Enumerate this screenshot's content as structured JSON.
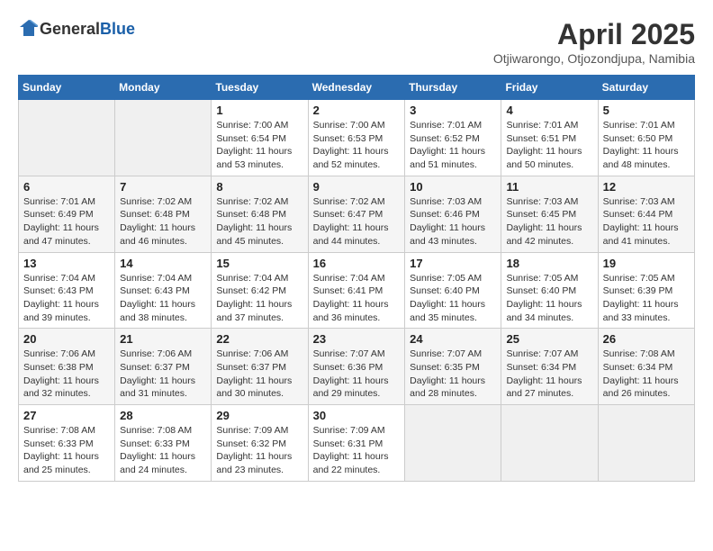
{
  "header": {
    "logo_general": "General",
    "logo_blue": "Blue",
    "title": "April 2025",
    "location": "Otjiwarongo, Otjozondjupa, Namibia"
  },
  "weekdays": [
    "Sunday",
    "Monday",
    "Tuesday",
    "Wednesday",
    "Thursday",
    "Friday",
    "Saturday"
  ],
  "weeks": [
    [
      {
        "day": "",
        "info": ""
      },
      {
        "day": "",
        "info": ""
      },
      {
        "day": "1",
        "info": "Sunrise: 7:00 AM\nSunset: 6:54 PM\nDaylight: 11 hours and 53 minutes."
      },
      {
        "day": "2",
        "info": "Sunrise: 7:00 AM\nSunset: 6:53 PM\nDaylight: 11 hours and 52 minutes."
      },
      {
        "day": "3",
        "info": "Sunrise: 7:01 AM\nSunset: 6:52 PM\nDaylight: 11 hours and 51 minutes."
      },
      {
        "day": "4",
        "info": "Sunrise: 7:01 AM\nSunset: 6:51 PM\nDaylight: 11 hours and 50 minutes."
      },
      {
        "day": "5",
        "info": "Sunrise: 7:01 AM\nSunset: 6:50 PM\nDaylight: 11 hours and 48 minutes."
      }
    ],
    [
      {
        "day": "6",
        "info": "Sunrise: 7:01 AM\nSunset: 6:49 PM\nDaylight: 11 hours and 47 minutes."
      },
      {
        "day": "7",
        "info": "Sunrise: 7:02 AM\nSunset: 6:48 PM\nDaylight: 11 hours and 46 minutes."
      },
      {
        "day": "8",
        "info": "Sunrise: 7:02 AM\nSunset: 6:48 PM\nDaylight: 11 hours and 45 minutes."
      },
      {
        "day": "9",
        "info": "Sunrise: 7:02 AM\nSunset: 6:47 PM\nDaylight: 11 hours and 44 minutes."
      },
      {
        "day": "10",
        "info": "Sunrise: 7:03 AM\nSunset: 6:46 PM\nDaylight: 11 hours and 43 minutes."
      },
      {
        "day": "11",
        "info": "Sunrise: 7:03 AM\nSunset: 6:45 PM\nDaylight: 11 hours and 42 minutes."
      },
      {
        "day": "12",
        "info": "Sunrise: 7:03 AM\nSunset: 6:44 PM\nDaylight: 11 hours and 41 minutes."
      }
    ],
    [
      {
        "day": "13",
        "info": "Sunrise: 7:04 AM\nSunset: 6:43 PM\nDaylight: 11 hours and 39 minutes."
      },
      {
        "day": "14",
        "info": "Sunrise: 7:04 AM\nSunset: 6:43 PM\nDaylight: 11 hours and 38 minutes."
      },
      {
        "day": "15",
        "info": "Sunrise: 7:04 AM\nSunset: 6:42 PM\nDaylight: 11 hours and 37 minutes."
      },
      {
        "day": "16",
        "info": "Sunrise: 7:04 AM\nSunset: 6:41 PM\nDaylight: 11 hours and 36 minutes."
      },
      {
        "day": "17",
        "info": "Sunrise: 7:05 AM\nSunset: 6:40 PM\nDaylight: 11 hours and 35 minutes."
      },
      {
        "day": "18",
        "info": "Sunrise: 7:05 AM\nSunset: 6:40 PM\nDaylight: 11 hours and 34 minutes."
      },
      {
        "day": "19",
        "info": "Sunrise: 7:05 AM\nSunset: 6:39 PM\nDaylight: 11 hours and 33 minutes."
      }
    ],
    [
      {
        "day": "20",
        "info": "Sunrise: 7:06 AM\nSunset: 6:38 PM\nDaylight: 11 hours and 32 minutes."
      },
      {
        "day": "21",
        "info": "Sunrise: 7:06 AM\nSunset: 6:37 PM\nDaylight: 11 hours and 31 minutes."
      },
      {
        "day": "22",
        "info": "Sunrise: 7:06 AM\nSunset: 6:37 PM\nDaylight: 11 hours and 30 minutes."
      },
      {
        "day": "23",
        "info": "Sunrise: 7:07 AM\nSunset: 6:36 PM\nDaylight: 11 hours and 29 minutes."
      },
      {
        "day": "24",
        "info": "Sunrise: 7:07 AM\nSunset: 6:35 PM\nDaylight: 11 hours and 28 minutes."
      },
      {
        "day": "25",
        "info": "Sunrise: 7:07 AM\nSunset: 6:34 PM\nDaylight: 11 hours and 27 minutes."
      },
      {
        "day": "26",
        "info": "Sunrise: 7:08 AM\nSunset: 6:34 PM\nDaylight: 11 hours and 26 minutes."
      }
    ],
    [
      {
        "day": "27",
        "info": "Sunrise: 7:08 AM\nSunset: 6:33 PM\nDaylight: 11 hours and 25 minutes."
      },
      {
        "day": "28",
        "info": "Sunrise: 7:08 AM\nSunset: 6:33 PM\nDaylight: 11 hours and 24 minutes."
      },
      {
        "day": "29",
        "info": "Sunrise: 7:09 AM\nSunset: 6:32 PM\nDaylight: 11 hours and 23 minutes."
      },
      {
        "day": "30",
        "info": "Sunrise: 7:09 AM\nSunset: 6:31 PM\nDaylight: 11 hours and 22 minutes."
      },
      {
        "day": "",
        "info": ""
      },
      {
        "day": "",
        "info": ""
      },
      {
        "day": "",
        "info": ""
      }
    ]
  ]
}
